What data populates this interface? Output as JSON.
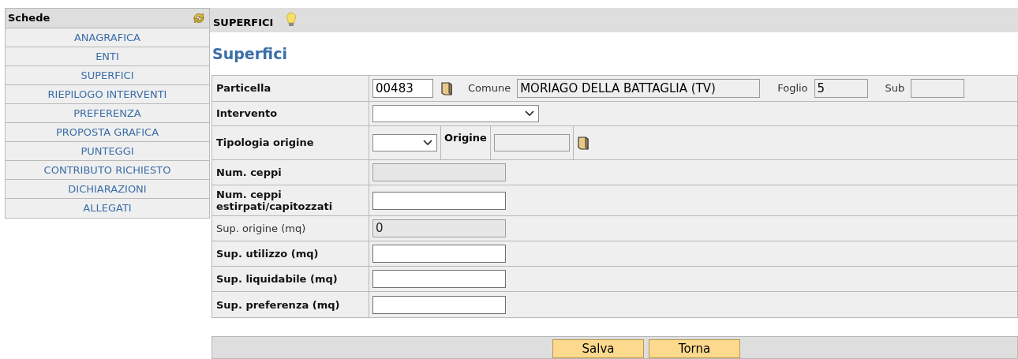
{
  "sidebar": {
    "title": "Schede",
    "items": [
      {
        "label": "ANAGRAFICA"
      },
      {
        "label": "ENTI"
      },
      {
        "label": "SUPERFICI"
      },
      {
        "label": "RIEPILOGO INTERVENTI"
      },
      {
        "label": "PREFERENZA"
      },
      {
        "label": "PROPOSTA GRAFICA"
      },
      {
        "label": "PUNTEGGI"
      },
      {
        "label": "CONTRIBUTO RICHIESTO"
      },
      {
        "label": "DICHIARAZIONI"
      },
      {
        "label": "ALLEGATI"
      }
    ]
  },
  "tab": {
    "title": "SUPERFICI"
  },
  "heading": "Superfici",
  "form": {
    "particella": {
      "label": "Particella",
      "value": "00483",
      "comune_label": "Comune",
      "comune": "MORIAGO DELLA BATTAGLIA (TV)",
      "foglio_label": "Foglio",
      "foglio": "5",
      "sub_label": "Sub"
    },
    "intervento": {
      "label": "Intervento"
    },
    "tipologia": {
      "label": "Tipologia origine",
      "origine_label": "Origine"
    },
    "rows": [
      {
        "label": "Num. ceppi",
        "required": true,
        "disabled": true
      },
      {
        "label": "Num. ceppi estirpati/capitozzati",
        "required": true,
        "disabled": false
      },
      {
        "label": "Sup. origine (mq)",
        "required": false,
        "disabled": true,
        "value": "0"
      },
      {
        "label": "Sup. utilizzo (mq)",
        "required": true,
        "disabled": false
      },
      {
        "label": "Sup. liquidabile (mq)",
        "required": true,
        "disabled": false
      },
      {
        "label": "Sup. preferenza (mq)",
        "required": true,
        "disabled": false
      }
    ]
  },
  "buttons": [
    "Salva",
    "Torna"
  ]
}
